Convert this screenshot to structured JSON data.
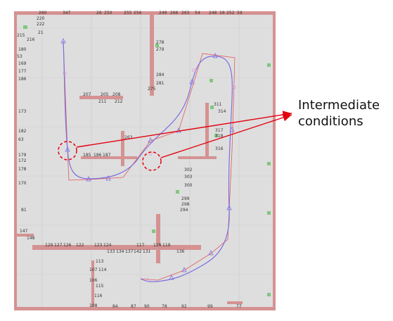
{
  "annotation": {
    "line1": "Intermediate",
    "line2": "conditions",
    "arrow_color": "#e3000f",
    "highlight_circle_color": "#e3000f"
  },
  "colors": {
    "board_bg": "#dedede",
    "grid_line": "#cfcfcf",
    "component_bar": "#d58a8a",
    "component_bar_light": "#e9b8b8",
    "pad_green": "#7fc77f",
    "route_curve": "#7b6fe0",
    "control_polygon": "#e35a5a"
  },
  "board_labels": [
    "260",
    "347",
    "26",
    "250",
    "255",
    "256",
    "249",
    "266",
    "263",
    "54",
    "246",
    "16",
    "252",
    "59",
    "220",
    "222",
    "215",
    "216",
    "21",
    "278",
    "180",
    "279",
    "53",
    "169",
    "177",
    "284",
    "186",
    "281",
    "275",
    "207",
    "205",
    "208",
    "211",
    "212",
    "263",
    "173",
    "311",
    "314",
    "182",
    "317",
    "318",
    "63",
    "316",
    "179",
    "172",
    "178",
    "185",
    "186",
    "187",
    "302",
    "303",
    "300",
    "170",
    "299",
    "298",
    "294",
    "81",
    "147",
    "148",
    "129",
    "127",
    "126",
    "122",
    "123",
    "124",
    "117",
    "128",
    "119",
    "133",
    "134",
    "137",
    "142",
    "131",
    "136",
    "113",
    "114",
    "107",
    "106",
    "115",
    "116",
    "108",
    "84",
    "87",
    "90",
    "78",
    "92",
    "99",
    "77"
  ]
}
